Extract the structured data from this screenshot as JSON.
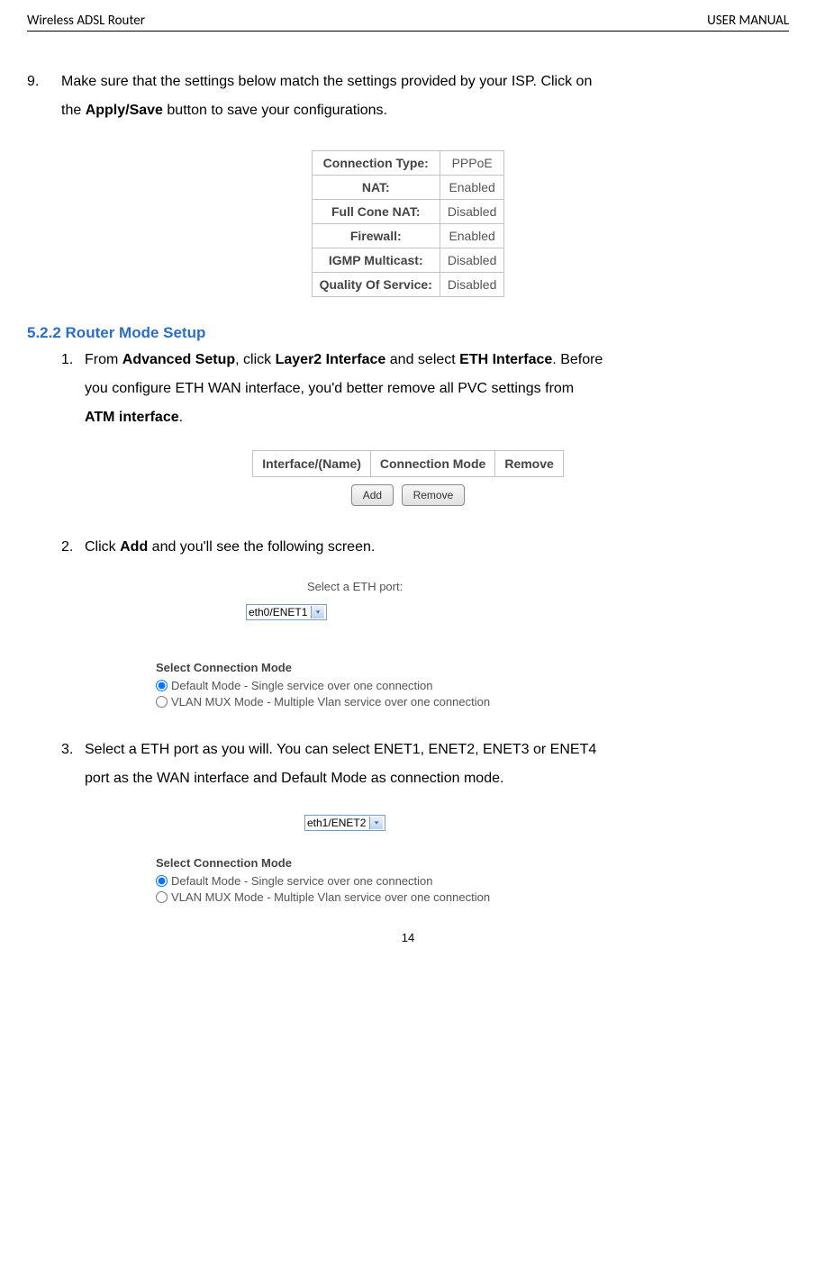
{
  "header": {
    "left": "Wireless ADSL Router",
    "right": "USER MANUAL"
  },
  "step9": {
    "number": "9.",
    "text1": "Make sure that the settings below match the settings provided by your ISP. Click on",
    "text2_prefix": "the ",
    "text2_bold": "Apply/Save",
    "text2_suffix": " button to save your configurations."
  },
  "settings": [
    {
      "label": "Connection Type:",
      "value": "PPPoE"
    },
    {
      "label": "NAT:",
      "value": "Enabled"
    },
    {
      "label": "Full Cone NAT:",
      "value": "Disabled"
    },
    {
      "label": "Firewall:",
      "value": "Enabled"
    },
    {
      "label": "IGMP Multicast:",
      "value": "Disabled"
    },
    {
      "label": "Quality Of Service:",
      "value": "Disabled"
    }
  ],
  "section_heading": "5.2.2 Router Mode Setup",
  "step1": {
    "number": "1.",
    "p1": "From ",
    "b1": "Advanced Setup",
    "p2": ", click ",
    "b2": "Layer2 Interface",
    "p3": " and select ",
    "b3": "ETH Interface",
    "p4": ". Before",
    "line2": "you configure ETH WAN interface, you'd better remove all PVC settings from",
    "b4": "ATM interface",
    "p5": "."
  },
  "interface_headers": [
    "Interface/(Name)",
    "Connection Mode",
    "Remove"
  ],
  "buttons": {
    "add": "Add",
    "remove": "Remove"
  },
  "step2": {
    "number": "2.",
    "p1": "Click ",
    "b1": "Add",
    "p2": " and you'll see the following screen."
  },
  "eth1": {
    "label": "Select a ETH port:",
    "select": "eth0/ENET1",
    "conn_heading": "Select Connection Mode",
    "opt1": "Default Mode - Single service over one connection",
    "opt2": "VLAN MUX Mode - Multiple Vlan service over one connection"
  },
  "step3": {
    "number": "3.",
    "line1": "Select a ETH port as you will. You can select ENET1, ENET2, ENET3 or    ENET4",
    "line2": "port as the WAN interface and Default Mode as connection mode."
  },
  "eth2": {
    "select": "eth1/ENET2",
    "conn_heading": "Select Connection Mode",
    "opt1": "Default Mode - Single service over one connection",
    "opt2": "VLAN MUX Mode - Multiple Vlan service over one connection"
  },
  "page_number": "14"
}
